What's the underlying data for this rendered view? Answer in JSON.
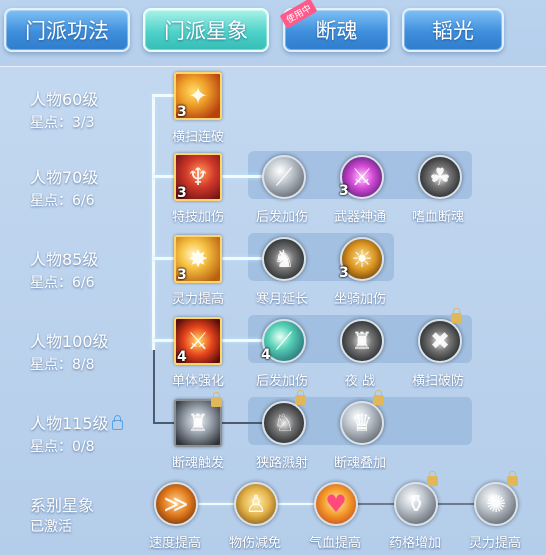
{
  "tabs": [
    {
      "label": "门派功法",
      "active": false
    },
    {
      "label": "门派星象",
      "active": true
    },
    {
      "label": "断魂",
      "active": false,
      "badge": "使用中"
    },
    {
      "label": "韬光",
      "active": false
    }
  ],
  "levels": [
    {
      "name": "人物60级",
      "points": "星点：3/3"
    },
    {
      "name": "人物70级",
      "points": "星点：6/6"
    },
    {
      "name": "人物85级",
      "points": "星点：6/6"
    },
    {
      "name": "人物100级",
      "points": "星点：8/8"
    },
    {
      "name": "人物115级",
      "points": "星点：0/8",
      "locked": true
    }
  ],
  "skills": {
    "r1": [
      {
        "label": "横扫连破",
        "count": "3",
        "icon": "sweep-icon"
      }
    ],
    "r2": [
      {
        "label": "特技加伤",
        "count": "3",
        "icon": "claw-icon"
      },
      {
        "label": "后发加伤",
        "count": "",
        "icon": "slash-icon"
      },
      {
        "label": "武器神通",
        "count": "3",
        "icon": "weapon-glow-icon"
      },
      {
        "label": "嗜血断魂",
        "count": "",
        "icon": "blood-claw-icon"
      }
    ],
    "r3": [
      {
        "label": "灵力提高",
        "count": "3",
        "icon": "spirit-burst-icon"
      },
      {
        "label": "寒月延长",
        "count": "",
        "icon": "shadow-warrior-icon"
      },
      {
        "label": "坐骑加伤",
        "count": "3",
        "icon": "beast-icon"
      }
    ],
    "r4": [
      {
        "label": "单体强化",
        "count": "4",
        "icon": "flame-sword-icon"
      },
      {
        "label": "后发加伤",
        "count": "4",
        "icon": "teal-slash-icon"
      },
      {
        "label": "夜 战",
        "count": "",
        "icon": "night-fighter-icon"
      },
      {
        "label": "横扫破防",
        "count": "",
        "icon": "break-defense-icon",
        "locked": true
      }
    ],
    "r5": [
      {
        "label": "断魂触发",
        "count": "",
        "icon": "armor-icon",
        "locked": true
      },
      {
        "label": "狭路溅射",
        "count": "",
        "icon": "leaping-warrior-icon",
        "locked": true
      },
      {
        "label": "断魂叠加",
        "count": "",
        "icon": "giant-icon",
        "locked": true
      }
    ]
  },
  "system": {
    "title": "系别星象",
    "status": "已激活",
    "items": [
      {
        "label": "速度提高",
        "icon": "speed-icon"
      },
      {
        "label": "物伤减免",
        "icon": "shield-figure-icon"
      },
      {
        "label": "气血提高",
        "icon": "heart-icon"
      },
      {
        "label": "药格增加",
        "icon": "potion-icon",
        "locked": true
      },
      {
        "label": "灵力提高",
        "icon": "spirit-icon",
        "locked": true
      }
    ]
  }
}
